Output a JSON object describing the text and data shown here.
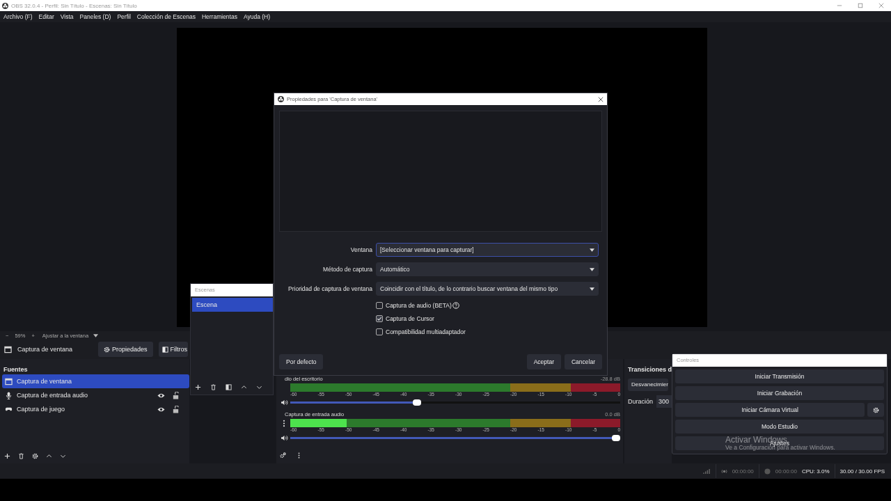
{
  "window": {
    "title": "OBS 32.0.4 - Perfil: Sin Título - Escenas: Sin Título"
  },
  "menu": [
    "Archivo (F)",
    "Editar",
    "Vista",
    "Paneles (D)",
    "Perfil",
    "Colección de Escenas",
    "Herramientas",
    "Ayuda (H)"
  ],
  "zoom_bar": {
    "zoom_out": "−",
    "zoom": "59%",
    "zoom_in": "+",
    "fit": "Ajustar a la ventana"
  },
  "source_toolbar": {
    "source": "Captura de ventana",
    "buttons": [
      "Propiedades",
      "Filtros"
    ]
  },
  "sources": {
    "title": "Fuentes",
    "items": [
      {
        "name": "Captura de ventana",
        "kind": "window",
        "selected": true
      },
      {
        "name": "Captura de entrada audio",
        "kind": "mic",
        "selected": false,
        "visible": true,
        "locked": false
      },
      {
        "name": "Captura de juego",
        "kind": "gamepad",
        "selected": false,
        "visible": true,
        "locked": false
      }
    ]
  },
  "scenes": {
    "title": "Escenas",
    "items": [
      {
        "name": "Escena",
        "selected": true
      }
    ]
  },
  "mixer": {
    "channels": [
      {
        "name": "dio del escritorio",
        "reading": "-28.8 dB",
        "scale": [
          "-60",
          "-55",
          "-50",
          "-45",
          "-40",
          "-35",
          "-30",
          "-25",
          "-20",
          "-15",
          "-10",
          "-5",
          "0"
        ],
        "volume": {
          "level": 0.38
        }
      },
      {
        "name": "Captura de entrada audio",
        "reading": "0.0 dB",
        "scale": [
          "-60",
          "-55",
          "-50",
          "-45",
          "-40",
          "-35",
          "-30",
          "-25",
          "-20",
          "-15",
          "-10",
          "-5",
          "0"
        ],
        "meter": {
          "level": 0.17
        },
        "volume": {
          "level": 1
        }
      }
    ]
  },
  "transitions": {
    "title": "Transiciones d",
    "transition": "Desvanecimier",
    "duration_label": "Duración",
    "duration": "300"
  },
  "controls": {
    "title": "Controles",
    "buttons": [
      {
        "label": "Iniciar Transmisión",
        "settings": false
      },
      {
        "label": "Iniciar Grabación",
        "settings": false
      },
      {
        "label": "Iniciar Cámara Virtual",
        "settings": true
      },
      {
        "label": "Modo Estudio",
        "settings": false
      },
      {
        "label": "Ajustes",
        "settings": false
      }
    ]
  },
  "activation_notice": {
    "title": "Activar Windows",
    "text": "Ve a Configuración para activar Windows."
  },
  "status_bar": {
    "stream_time": "00:00:00",
    "record_time": "00:00:00",
    "cpu": "CPU: 3.0%",
    "fps": "30.00 / 30.00 FPS"
  },
  "dialog": {
    "title": "Propiedades para 'Captura de ventana'",
    "fields": [
      {
        "label": "Ventana",
        "value": "[Seleccionar ventana para capturar]",
        "focused": true
      },
      {
        "label": "Método de captura",
        "value": "Automático",
        "focused": false
      },
      {
        "label": "Prioridad de captura de ventana",
        "value": "Coincidir con el título, de lo contrario buscar ventana del mismo tipo",
        "focused": false
      }
    ],
    "checkboxes": [
      {
        "label": "Captura de audio (BETA)",
        "checked": false,
        "help": true
      },
      {
        "label": "Captura de Cursor",
        "checked": true,
        "help": false
      },
      {
        "label": "Compatibilidad multiadaptador",
        "checked": false,
        "help": false
      }
    ],
    "left_button": "Por defecto",
    "buttons": [
      "Aceptar",
      "Cancelar"
    ]
  }
}
